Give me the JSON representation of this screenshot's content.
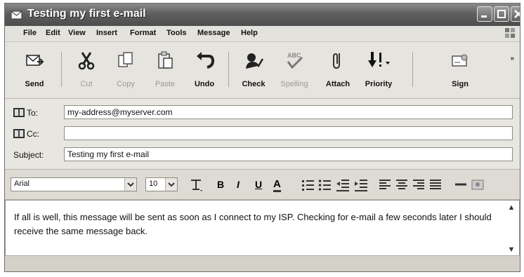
{
  "window": {
    "title": "Testing my first e-mail"
  },
  "menu": [
    "File",
    "Edit",
    "View",
    "Insert",
    "Format",
    "Tools",
    "Message",
    "Help"
  ],
  "toolbar": {
    "send": "Send",
    "cut": "Cut",
    "copy": "Copy",
    "paste": "Paste",
    "undo": "Undo",
    "check": "Check",
    "spelling": "Spelling",
    "attach": "Attach",
    "priority": "Priority",
    "sign": "Sign",
    "spelling_icon_text": "ABC"
  },
  "headers": {
    "to_label": "To:",
    "to_value": "my-address@myserver.com",
    "cc_label": "Cc:",
    "cc_value": "",
    "subject_label": "Subject:",
    "subject_value": "Testing my first e-mail"
  },
  "format": {
    "font": "Arial",
    "size": "10",
    "bold": "B",
    "italic": "I",
    "underline": "U",
    "font_color": "A"
  },
  "body": {
    "text": "If all is well, this message will be sent as soon as I connect to my ISP. Checking for e-mail a few seconds later I should receive the same message back."
  },
  "colors": {
    "titlebar": "#5f5f5f",
    "toolbar": "#e6e4de",
    "window": "#d9d6cf"
  },
  "icons": {
    "send": "send-icon",
    "cut": "scissors-icon",
    "copy": "copy-icon",
    "paste": "paste-icon",
    "undo": "undo-icon",
    "check": "check-names-icon",
    "spelling": "spelling-icon",
    "attach": "paperclip-icon",
    "priority": "priority-icon",
    "sign": "digital-sign-icon"
  }
}
